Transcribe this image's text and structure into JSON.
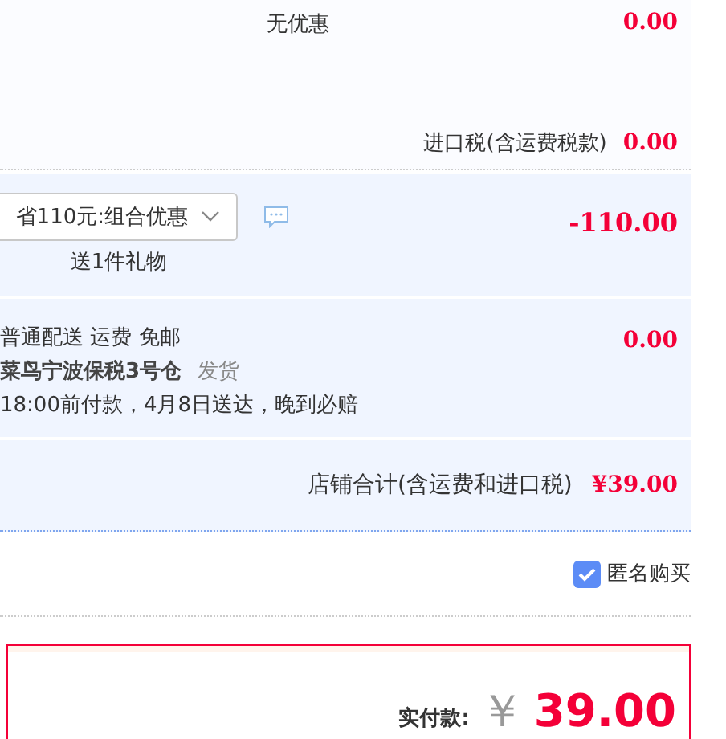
{
  "discount": {
    "label": "无优惠",
    "amount": "0.00"
  },
  "import_tax": {
    "label": "进口税(含运费税款)",
    "amount": "0.00"
  },
  "promotion": {
    "value": "省110元:组合优惠",
    "gift": "送1件礼物",
    "amount": "-110.00"
  },
  "shipping": {
    "method": "普通配送 运费 免邮",
    "warehouse": "菜鸟宁波保税3号仓",
    "ship_note": "发货",
    "delivery": "18:00前付款，4月8日送达，晚到必赔",
    "amount": "0.00"
  },
  "store_total": {
    "label": "店铺合计(含运费和进口税)",
    "amount": "¥39.00"
  },
  "anonymous": {
    "label": "匿名购买",
    "checked": true
  },
  "payment": {
    "label": "实付款:",
    "currency": "￥",
    "amount": "39.00"
  }
}
